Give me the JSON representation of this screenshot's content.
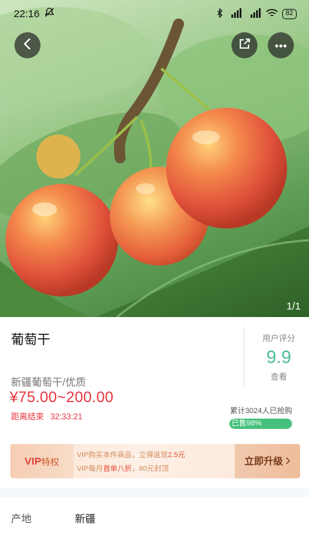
{
  "status_bar": {
    "time": "22:16",
    "battery": "82"
  },
  "gallery": {
    "page_indicator": "1/1"
  },
  "product": {
    "name": "葡萄干",
    "subtitle": "新疆葡萄干/优质",
    "price": "¥75.00~200.00",
    "countdown_label": "距离结束",
    "countdown_time": "32:33:21"
  },
  "rating": {
    "label": "用户评分",
    "score": "9.9",
    "view_label": "查看"
  },
  "sales": {
    "count_text": "累计3024人已抢购",
    "progress_label": "已售98%",
    "progress_percent": 98
  },
  "vip_banner": {
    "tag_en": "VIP",
    "tag_cn": "特权",
    "line1_prefix": "VIP购买本件商品，立得返现",
    "line1_highlight": "2.5元",
    "line2_prefix": "VIP每月",
    "line2_highlight": "首单八折",
    "line2_suffix": "，80元封顶",
    "upgrade_label": "立即升级"
  },
  "specs": [
    {
      "key": "产地",
      "value": "新疆"
    }
  ],
  "colors": {
    "price_red": "#e8343f",
    "rating_green": "#4bbd8e",
    "progress_green": "#44c07a"
  }
}
